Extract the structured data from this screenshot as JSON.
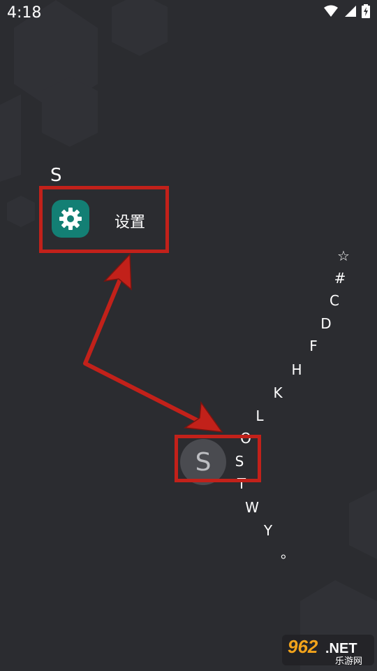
{
  "status_bar": {
    "time": "4:18"
  },
  "app_list": {
    "section_letter": "S",
    "items": [
      {
        "label": "设置",
        "icon": "gear-icon"
      }
    ]
  },
  "alphabet_index": [
    "☆",
    "#",
    "C",
    "D",
    "F",
    "H",
    "K",
    "L",
    "O",
    "S",
    "T",
    "W",
    "Y",
    "。"
  ],
  "selected_letter": "S",
  "watermark": {
    "brand": "962.NET",
    "sub": "乐游网"
  },
  "colors": {
    "background": "#2b2c30",
    "highlight": "#c2211a",
    "app_icon": "#137f74"
  }
}
